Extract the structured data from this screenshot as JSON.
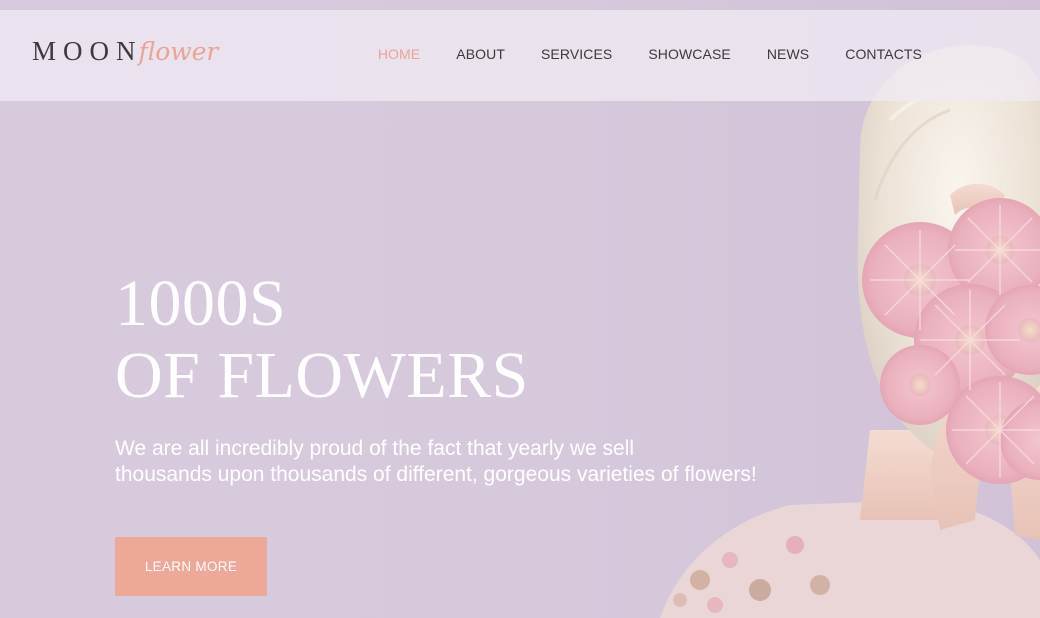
{
  "brand": {
    "logo_main": "MOON",
    "logo_accent": "flower"
  },
  "nav": {
    "items": [
      {
        "label": "HOME",
        "active": true
      },
      {
        "label": "ABOUT",
        "active": false
      },
      {
        "label": "SERVICES",
        "active": false
      },
      {
        "label": "SHOWCASE",
        "active": false
      },
      {
        "label": "NEWS",
        "active": false
      },
      {
        "label": "CONTACTS",
        "active": false
      }
    ]
  },
  "hero": {
    "title_line1": "1000S",
    "title_line2": "OF FLOWERS",
    "text_line1": "We are all incredibly proud of the fact that yearly we sell",
    "text_line2": "thousands upon thousands of different, gorgeous varieties of flowers!",
    "cta_label": "LEARN MORE"
  },
  "colors": {
    "accent": "#eaa394",
    "background": "#d6c8dc",
    "header_bg": "#f0e9f2",
    "text_dark": "#3a3a3a",
    "text_light": "#ffffff"
  }
}
